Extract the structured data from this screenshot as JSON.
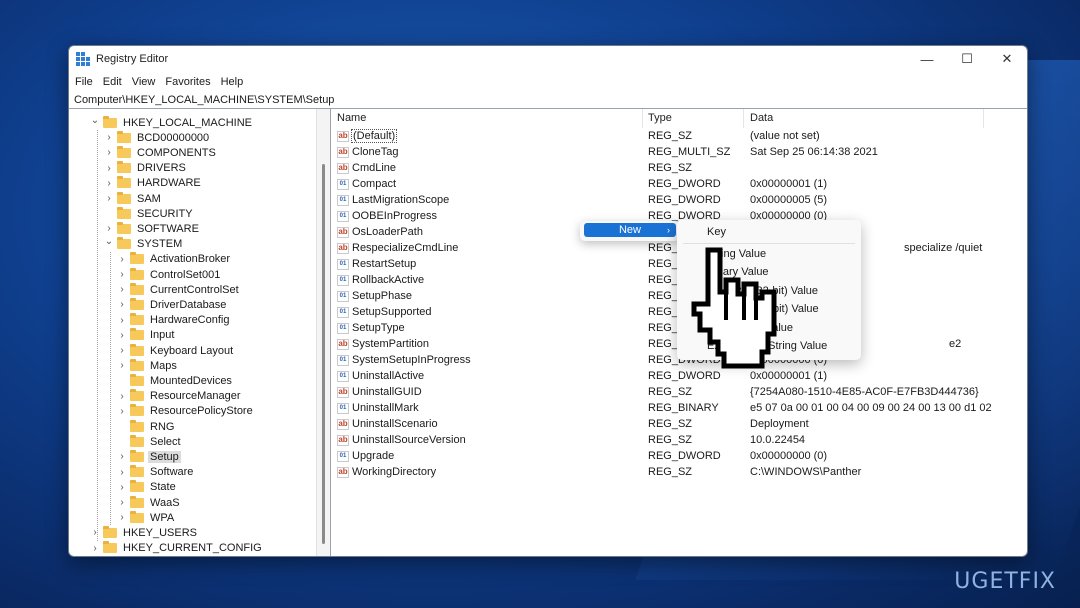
{
  "window": {
    "title": "Registry Editor",
    "controls": {
      "minimize": "—",
      "maximize": "☐",
      "close": "✕"
    }
  },
  "menubar": [
    "File",
    "Edit",
    "View",
    "Favorites",
    "Help"
  ],
  "address": "Computer\\HKEY_LOCAL_MACHINE\\SYSTEM\\Setup",
  "tree": {
    "hklm": "HKEY_LOCAL_MACHINE",
    "hklm_children": [
      "BCD00000000",
      "COMPONENTS",
      "DRIVERS",
      "HARDWARE",
      "SAM",
      "SECURITY",
      "SOFTWARE",
      "SYSTEM"
    ],
    "system_children": [
      "ActivationBroker",
      "ControlSet001",
      "CurrentControlSet",
      "DriverDatabase",
      "HardwareConfig",
      "Input",
      "Keyboard Layout",
      "Maps",
      "MountedDevices",
      "ResourceManager",
      "ResourcePolicyStore",
      "RNG",
      "Select",
      "Setup",
      "Software",
      "State",
      "WaaS",
      "WPA"
    ],
    "selected": "Setup",
    "roots_after": [
      "HKEY_USERS",
      "HKEY_CURRENT_CONFIG"
    ]
  },
  "list": {
    "headers": {
      "name": "Name",
      "type": "Type",
      "data": "Data"
    },
    "rows": [
      {
        "icon": "string-value-icon",
        "name": "(Default)",
        "type": "REG_SZ",
        "data": "(value not set)"
      },
      {
        "icon": "string-value-icon",
        "name": "CloneTag",
        "type": "REG_MULTI_SZ",
        "data": "Sat Sep 25 06:14:38 2021"
      },
      {
        "icon": "string-value-icon",
        "name": "CmdLine",
        "type": "REG_SZ",
        "data": ""
      },
      {
        "icon": "binary-value-icon",
        "name": "Compact",
        "type": "REG_DWORD",
        "data": "0x00000001 (1)"
      },
      {
        "icon": "binary-value-icon",
        "name": "LastMigrationScope",
        "type": "REG_DWORD",
        "data": "0x00000005 (5)"
      },
      {
        "icon": "binary-value-icon",
        "name": "OOBEInProgress",
        "type": "REG_DWORD",
        "data": "0x00000000 (0)"
      },
      {
        "icon": "string-value-icon",
        "name": "OsLoaderPath",
        "type": "",
        "data": ""
      },
      {
        "icon": "string-value-icon",
        "name": "RespecializeCmdLine",
        "type": "REG_",
        "data": "specialize /quiet"
      },
      {
        "icon": "binary-value-icon",
        "name": "RestartSetup",
        "type": "REG_",
        "data": ""
      },
      {
        "icon": "binary-value-icon",
        "name": "RollbackActive",
        "type": "REG_",
        "data": ""
      },
      {
        "icon": "binary-value-icon",
        "name": "SetupPhase",
        "type": "REG_",
        "data": ""
      },
      {
        "icon": "binary-value-icon",
        "name": "SetupSupported",
        "type": "REG_",
        "data": ""
      },
      {
        "icon": "binary-value-icon",
        "name": "SetupType",
        "type": "REG_",
        "data": ""
      },
      {
        "icon": "string-value-icon",
        "name": "SystemPartition",
        "type": "REG_",
        "data": "e2"
      },
      {
        "icon": "binary-value-icon",
        "name": "SystemSetupInProgress",
        "type": "REG_DWORD",
        "data": "0x00000000 (0)"
      },
      {
        "icon": "binary-value-icon",
        "name": "UninstallActive",
        "type": "REG_DWORD",
        "data": "0x00000001 (1)"
      },
      {
        "icon": "string-value-icon",
        "name": "UninstallGUID",
        "type": "REG_SZ",
        "data": "{7254A080-1510-4E85-AC0F-E7FB3D444736}"
      },
      {
        "icon": "binary-value-icon",
        "name": "UninstallMark",
        "type": "REG_BINARY",
        "data": "e5 07 0a 00 01 00 04 00 09 00 24 00 13 00 d1 02"
      },
      {
        "icon": "string-value-icon",
        "name": "UninstallScenario",
        "type": "REG_SZ",
        "data": "Deployment"
      },
      {
        "icon": "string-value-icon",
        "name": "UninstallSourceVersion",
        "type": "REG_SZ",
        "data": "10.0.22454"
      },
      {
        "icon": "binary-value-icon",
        "name": "Upgrade",
        "type": "REG_DWORD",
        "data": "0x00000000 (0)"
      },
      {
        "icon": "string-value-icon",
        "name": "WorkingDirectory",
        "type": "REG_SZ",
        "data": "C:\\WINDOWS\\Panther"
      }
    ]
  },
  "context_menu": {
    "new_label": "New",
    "arrow": "›",
    "submenu": [
      "Key",
      "String Value",
      "Binary Value",
      "DWORD (32-bit) Value",
      "QWORD (64-bit) Value",
      "Multi-String Value",
      "Expandable String Value"
    ]
  },
  "icons": {
    "string": "ab",
    "binary": "011\n110",
    "chevron_right": "›",
    "chevron_down": "⌄"
  },
  "watermark": "UGETFIX"
}
